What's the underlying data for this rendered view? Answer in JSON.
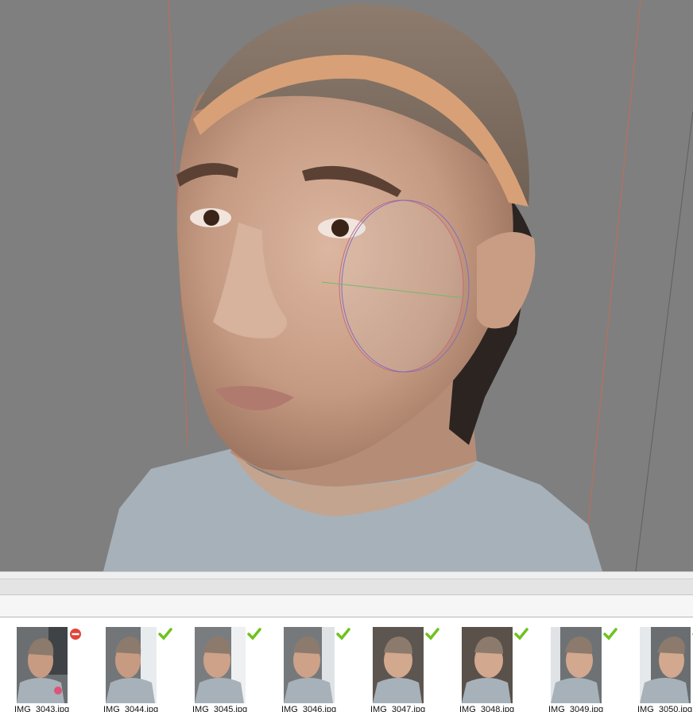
{
  "viewport": {
    "name": "3D model viewport",
    "background": "#7f7f7f",
    "bounding_box_color": "#c46b5a"
  },
  "photos": [
    {
      "file": "IMG_3043.jpg",
      "status": "excluded",
      "status_icon": "remove-icon"
    },
    {
      "file": "IMG_3044.jpg",
      "status": "aligned",
      "status_icon": "check-icon"
    },
    {
      "file": "IMG_3045.jpg",
      "status": "aligned",
      "status_icon": "check-icon"
    },
    {
      "file": "IMG_3046.jpg",
      "status": "aligned",
      "status_icon": "check-icon"
    },
    {
      "file": "IMG_3047.jpg",
      "status": "aligned",
      "status_icon": "check-icon"
    },
    {
      "file": "IMG_3048.jpg",
      "status": "aligned",
      "status_icon": "check-icon"
    },
    {
      "file": "IMG_3049.jpg",
      "status": "aligned",
      "status_icon": "check-icon"
    },
    {
      "file": "IMG_3050.jpg",
      "status": "aligned",
      "status_icon": "check-icon"
    }
  ],
  "colors": {
    "check": "#6fc21e",
    "remove": "#e0463a",
    "skin": "#caa087",
    "cap": "#d7a077",
    "shirt": "#a7b1b9"
  }
}
